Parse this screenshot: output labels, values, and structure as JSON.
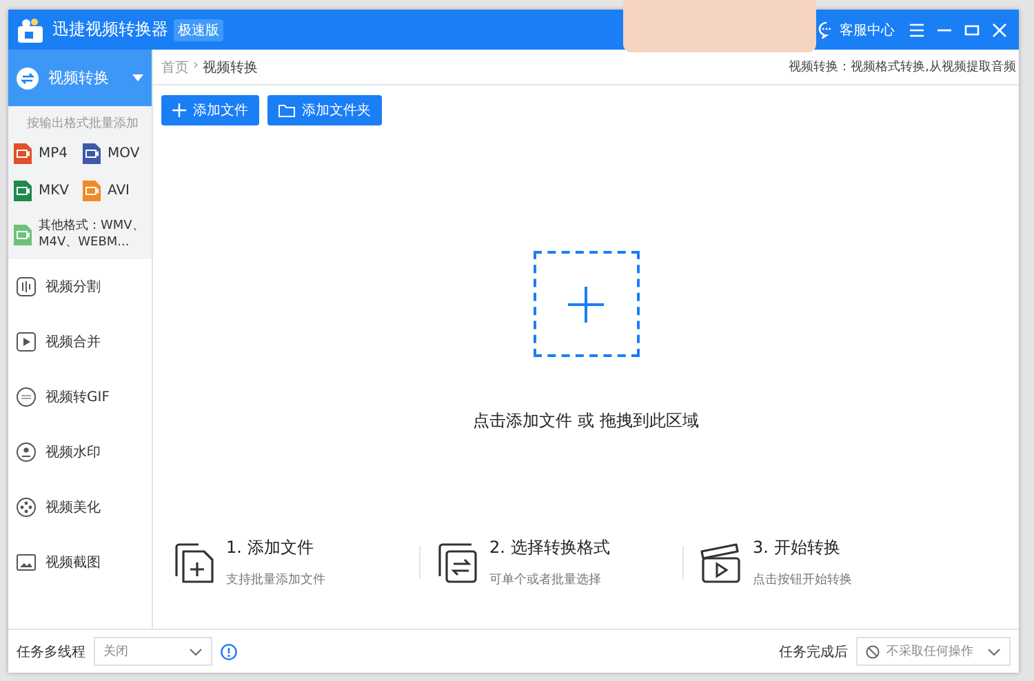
{
  "window": {
    "title": "迅捷视频转换器",
    "edition_badge": "极速版",
    "support": "客服中心"
  },
  "sidebar": {
    "active": {
      "label": "视频转换",
      "expanded": true
    },
    "hint": "按输出格式批量添加",
    "formats": [
      {
        "label": "MP4",
        "color": "#e0502a"
      },
      {
        "label": "MOV",
        "color": "#3c5aa8"
      },
      {
        "label": "MKV",
        "color": "#1e8a4c"
      },
      {
        "label": "AVI",
        "color": "#f08a24"
      }
    ],
    "other_formats": {
      "label": "其他格式：WMV、M4V、WEBM...",
      "color": "#6cc27a"
    },
    "items": [
      {
        "label": "视频分割",
        "kind": "split"
      },
      {
        "label": "视频合并",
        "kind": "merge"
      },
      {
        "label": "视频转GIF",
        "kind": "gif"
      },
      {
        "label": "视频水印",
        "kind": "watermark"
      },
      {
        "label": "视频美化",
        "kind": "beautify"
      },
      {
        "label": "视频截图",
        "kind": "screenshot"
      }
    ]
  },
  "breadcrumb": [
    "首页",
    "视频转换"
  ],
  "breadcrumb_separator": "›",
  "description": "视频转换：视频格式转换,从视频提取音频",
  "toolbar": [
    {
      "label": "添加文件",
      "kind": "file"
    },
    {
      "label": "添加文件夹",
      "kind": "folder"
    }
  ],
  "drop_zone": {
    "text": "点击添加文件 或 拖拽到此区域"
  },
  "steps": [
    {
      "title": "1. 添加文件",
      "subtitle": "支持批量添加文件",
      "kind": "add"
    },
    {
      "title": "2. 选择转换格式",
      "subtitle": "可单个或者批量选择",
      "kind": "convert"
    },
    {
      "title": "3. 开始转换",
      "subtitle": "点击按钮开始转换",
      "kind": "start"
    }
  ],
  "footer": {
    "threads_label": "任务多线程",
    "threads_value": "关闭",
    "after_label": "任务完成后",
    "after_value": "不采取任何操作"
  }
}
